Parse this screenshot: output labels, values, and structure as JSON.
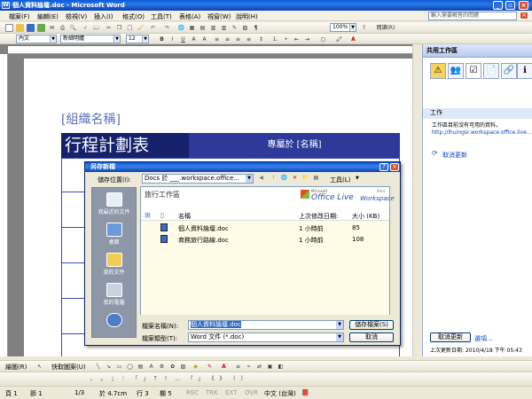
{
  "window": {
    "title": "個人資料論壇.doc - Microsoft Word",
    "ask_placeholder": "輸入需要解答的問題"
  },
  "menu": [
    "檔案(F)",
    "編輯(E)",
    "檢視(V)",
    "插入(I)",
    "格式(O)",
    "工具(T)",
    "表格(A)",
    "視窗(W)",
    "說明(H)"
  ],
  "toolbar": {
    "zoom": "100%",
    "read_label": "閱讀(R)"
  },
  "format_toolbar": {
    "style": "內文",
    "font": "新細明體",
    "size": "12"
  },
  "document": {
    "org_name": "[組織名稱]",
    "title": "行程計劃表",
    "subtitle": "專屬於 [名稱]"
  },
  "task_pane": {
    "title": "共用工作區",
    "section": "工作",
    "message": "工作區目前沒有可用的資料。",
    "url": "http://lhuingsr.workspace.office.live...",
    "cancel_update": "取消更新",
    "update_button": "取消更新",
    "options_link": "選項...",
    "last_updated": "上次更新日期: 2010/4/18 下午 05:43"
  },
  "dialog": {
    "title": "另存新檔",
    "save_in_label": "儲存位置(I):",
    "save_in_value": "Docs 於 ___.workspace.office...",
    "tools_label": "工具(L)",
    "places": [
      "我最近的文件",
      "桌面",
      "我的文件",
      "我的電腦",
      ""
    ],
    "folder_name": "旅行工作區",
    "brand": {
      "small": "Microsoft",
      "main": "Office Live",
      "sub": "Workspace",
      "badge": "Beta"
    },
    "columns": {
      "name": "名稱",
      "modified": "上次修改日期:",
      "size": "大小 (KB)"
    },
    "files": [
      {
        "name": "個人資料論壇.doc",
        "modified": "1 小時前",
        "size": "85"
      },
      {
        "name": "商務旅行路線.doc",
        "modified": "1 小時前",
        "size": "108"
      }
    ],
    "filename_label": "檔案名稱(N):",
    "filename_value": "個人資料論壇.doc",
    "filetype_label": "檔案類型(T):",
    "filetype_value": "Word 文件 (*.doc)",
    "save_button": "儲存檔案(S)",
    "cancel_button": "取消"
  },
  "drawing_toolbar": {
    "draw_label": "繪圖(R)",
    "autoshape_label": "快取圖案(U)"
  },
  "status_bar": {
    "page": "頁 1",
    "section": "節 1",
    "page_of": "1/3",
    "position": "於 4.7cm",
    "line": "行 3",
    "column": "欄 5",
    "modes": [
      "REC",
      "TRK",
      "EXT",
      "OVR"
    ],
    "language": "中文 (台灣)"
  },
  "colors": {
    "title_blue": "#0a5bd6",
    "banner_dark": "#16216b",
    "banner_light": "#2d3a9a",
    "org_text": "#5d6fbd"
  }
}
